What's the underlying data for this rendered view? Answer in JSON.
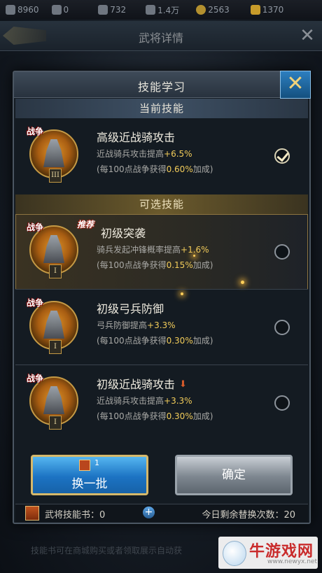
{
  "topbar": {
    "res1": "8960",
    "res2": "0",
    "res3": "732",
    "res4": "1.4万",
    "res5": "2563",
    "res6": "1370"
  },
  "background_header": {
    "title": "武将详情"
  },
  "dialog": {
    "title": "技能学习",
    "current_section": "当前技能",
    "optional_section": "可选技能",
    "current_skill": {
      "tag": "战争",
      "level": "III",
      "name": "高级近战骑攻击",
      "desc_prefix": "近战骑兵攻击提高",
      "desc_value": "+6.5%",
      "note_prefix": "(每100点战争获得",
      "note_value": "0.60%",
      "note_suffix": "加成)",
      "checked": true
    },
    "options": [
      {
        "tag": "战争",
        "badge": "推荐",
        "level": "I",
        "name": "初级突袭",
        "desc_prefix": "骑兵发起冲锋概率提高",
        "desc_value": "+1.6%",
        "note_prefix": "(每100点战争获得",
        "note_value": "0.15%",
        "note_suffix": "加成)"
      },
      {
        "tag": "战争",
        "level": "I",
        "name": "初级弓兵防御",
        "desc_prefix": "弓兵防御提高",
        "desc_value": "+3.3%",
        "note_prefix": "(每100点战争获得",
        "note_value": "0.30%",
        "note_suffix": "加成)"
      },
      {
        "tag": "战争",
        "level": "I",
        "name": "初级近战骑攻击",
        "desc_prefix": "近战骑兵攻击提高",
        "desc_value": "+3.3%",
        "note_prefix": "(每100点战争获得",
        "note_value": "0.30%",
        "note_suffix": "加成)"
      }
    ],
    "swap_button": {
      "cost": "1",
      "label": "换一批"
    },
    "confirm_button": {
      "label": "确定"
    },
    "footer": {
      "books_label": "武将技能书：0",
      "plus": "+",
      "remaining_label": "今日剩余替换次数：20"
    }
  },
  "bottom_hint": "技能书可在商城购买或者领取展示自动获",
  "watermark": {
    "title": "牛游戏网",
    "url": "www.newyx.net"
  },
  "colors": {
    "highlight": "#f2cc5a",
    "swap_button": "#1c73c3",
    "confirm_button": "#7d868f"
  },
  "icons": [
    "back-arrow-icon",
    "close-icon",
    "check-icon",
    "skill-book-icon",
    "plus-icon",
    "down-arrow-icon"
  ]
}
